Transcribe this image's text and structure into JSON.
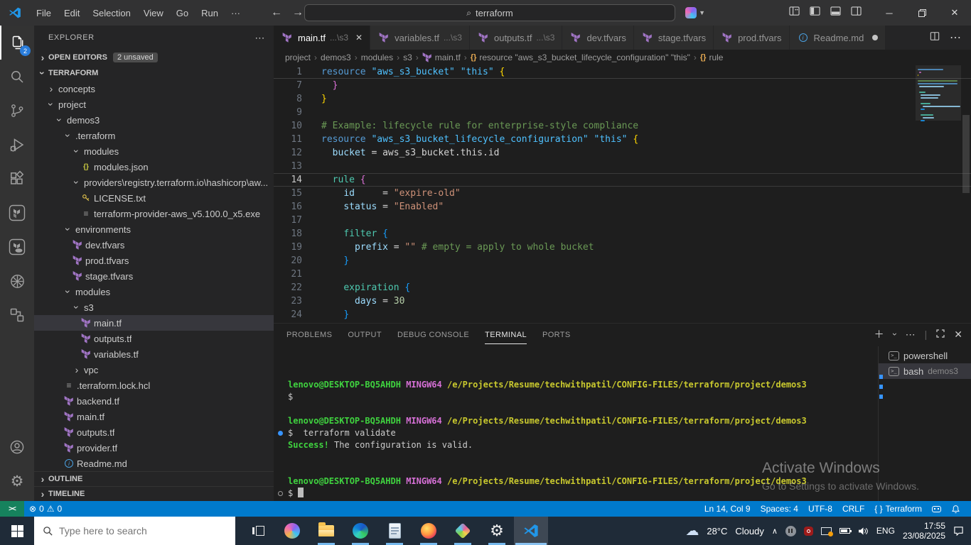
{
  "title_bar": {
    "menus": [
      "File",
      "Edit",
      "Selection",
      "View",
      "Go",
      "Run",
      "···"
    ],
    "search_value": "terraform"
  },
  "activity_bar": {
    "items": [
      {
        "id": "explorer",
        "badge": "2",
        "active": true
      },
      {
        "id": "search"
      },
      {
        "id": "source-control"
      },
      {
        "id": "run-debug"
      },
      {
        "id": "extensions"
      },
      {
        "id": "terraform"
      },
      {
        "id": "terraform-cloud"
      },
      {
        "id": "kubernetes"
      },
      {
        "id": "remote-explorer"
      }
    ],
    "bottom": [
      {
        "id": "account"
      },
      {
        "id": "settings"
      }
    ]
  },
  "sidebar": {
    "title": "EXPLORER",
    "open_editors_label": "OPEN EDITORS",
    "open_editors_badge": "2 unsaved",
    "root_label": "TERRAFORM",
    "sections": [
      "OUTLINE",
      "TIMELINE"
    ],
    "tree": [
      {
        "ind": 1,
        "chev": "closed",
        "label": "concepts"
      },
      {
        "ind": 1,
        "chev": "open",
        "label": "project"
      },
      {
        "ind": 2,
        "chev": "open",
        "label": "demos3"
      },
      {
        "ind": 3,
        "chev": "open",
        "label": ".terraform"
      },
      {
        "ind": 4,
        "chev": "open",
        "label": "modules"
      },
      {
        "ind": 5,
        "icon": "json",
        "label": "modules.json"
      },
      {
        "ind": 4,
        "chev": "open",
        "label": "providers\\registry.terraform.io\\hashicorp\\aw..."
      },
      {
        "ind": 5,
        "icon": "key",
        "label": "LICENSE.txt"
      },
      {
        "ind": 5,
        "icon": "list",
        "label": "terraform-provider-aws_v5.100.0_x5.exe"
      },
      {
        "ind": 3,
        "chev": "open",
        "label": "environments"
      },
      {
        "ind": 4,
        "icon": "terraform",
        "label": "dev.tfvars"
      },
      {
        "ind": 4,
        "icon": "terraform",
        "label": "prod.tfvars"
      },
      {
        "ind": 4,
        "icon": "terraform",
        "label": "stage.tfvars"
      },
      {
        "ind": 3,
        "chev": "open",
        "label": "modules"
      },
      {
        "ind": 4,
        "chev": "open",
        "label": "s3"
      },
      {
        "ind": 5,
        "icon": "terraform",
        "label": "main.tf",
        "selected": true
      },
      {
        "ind": 5,
        "icon": "terraform",
        "label": "outputs.tf"
      },
      {
        "ind": 5,
        "icon": "terraform",
        "label": "variables.tf"
      },
      {
        "ind": 4,
        "chev": "closed",
        "label": "vpc"
      },
      {
        "ind": 3,
        "icon": "list",
        "label": ".terraform.lock.hcl"
      },
      {
        "ind": 3,
        "icon": "terraform",
        "label": "backend.tf"
      },
      {
        "ind": 3,
        "icon": "terraform",
        "label": "main.tf"
      },
      {
        "ind": 3,
        "icon": "terraform",
        "label": "outputs.tf"
      },
      {
        "ind": 3,
        "icon": "terraform",
        "label": "provider.tf"
      },
      {
        "ind": 3,
        "icon": "markdown",
        "label": "Readme.md"
      }
    ]
  },
  "editor": {
    "tabs": [
      {
        "icon": "terraform",
        "label": "main.tf",
        "desc": "...\\s3",
        "active": true,
        "close": true
      },
      {
        "icon": "terraform",
        "label": "variables.tf",
        "desc": "...\\s3"
      },
      {
        "icon": "terraform",
        "label": "outputs.tf",
        "desc": "...\\s3"
      },
      {
        "icon": "terraform",
        "label": "dev.tfvars"
      },
      {
        "icon": "terraform",
        "label": "stage.tfvars"
      },
      {
        "icon": "terraform",
        "label": "prod.tfvars"
      },
      {
        "icon": "markdown",
        "label": "Readme.md",
        "modified": true
      }
    ],
    "breadcrumb": [
      {
        "label": "project"
      },
      {
        "label": "demos3"
      },
      {
        "label": "modules"
      },
      {
        "label": "s3"
      },
      {
        "icon": "terraform",
        "label": "main.tf"
      },
      {
        "icon": "symbol",
        "label": "resource \"aws_s3_bucket_lifecycle_configuration\" \"this\""
      },
      {
        "icon": "symbol",
        "label": "rule"
      }
    ],
    "code": {
      "sticky": {
        "num": "1",
        "tokens": [
          [
            "kw",
            "resource"
          ],
          [
            "pl",
            " "
          ],
          [
            "type",
            "\"aws_s3_bucket\""
          ],
          [
            "pl",
            " "
          ],
          [
            "type",
            "\"this\""
          ],
          [
            "pl",
            " "
          ],
          [
            "b1",
            "{"
          ]
        ]
      },
      "current_line": "14",
      "lines": [
        {
          "num": "7",
          "tokens": [
            [
              "pl",
              "  "
            ],
            [
              "b2",
              "}"
            ]
          ]
        },
        {
          "num": "8",
          "tokens": [
            [
              "b1",
              "}"
            ]
          ]
        },
        {
          "num": "9",
          "tokens": []
        },
        {
          "num": "10",
          "tokens": [
            [
              "cm",
              "# Example: lifecycle rule for enterprise-style compliance"
            ]
          ]
        },
        {
          "num": "11",
          "tokens": [
            [
              "kw",
              "resource"
            ],
            [
              "pl",
              " "
            ],
            [
              "type",
              "\"aws_s3_bucket_lifecycle_configuration\""
            ],
            [
              "pl",
              " "
            ],
            [
              "type",
              "\"this\""
            ],
            [
              "pl",
              " "
            ],
            [
              "b1",
              "{"
            ]
          ]
        },
        {
          "num": "12",
          "tokens": [
            [
              "pl",
              "  "
            ],
            [
              "prop",
              "bucket"
            ],
            [
              "pl",
              " = "
            ],
            [
              "ref",
              "aws_s3_bucket.this.id"
            ]
          ]
        },
        {
          "num": "13",
          "tokens": []
        },
        {
          "num": "14",
          "tokens": [
            [
              "pl",
              "  "
            ],
            [
              "blk",
              "rule"
            ],
            [
              "pl",
              " "
            ],
            [
              "b2",
              "{"
            ]
          ]
        },
        {
          "num": "15",
          "tokens": [
            [
              "pl",
              "    "
            ],
            [
              "prop",
              "id"
            ],
            [
              "pl",
              "     = "
            ],
            [
              "str",
              "\"expire-old\""
            ]
          ]
        },
        {
          "num": "16",
          "tokens": [
            [
              "pl",
              "    "
            ],
            [
              "prop",
              "status"
            ],
            [
              "pl",
              " = "
            ],
            [
              "str",
              "\"Enabled\""
            ]
          ]
        },
        {
          "num": "17",
          "tokens": []
        },
        {
          "num": "18",
          "tokens": [
            [
              "pl",
              "    "
            ],
            [
              "blk",
              "filter"
            ],
            [
              "pl",
              " "
            ],
            [
              "b3",
              "{"
            ]
          ]
        },
        {
          "num": "19",
          "tokens": [
            [
              "pl",
              "      "
            ],
            [
              "prop",
              "prefix"
            ],
            [
              "pl",
              " = "
            ],
            [
              "str",
              "\"\""
            ],
            [
              "pl",
              " "
            ],
            [
              "cm",
              "# empty = apply to whole bucket"
            ]
          ]
        },
        {
          "num": "20",
          "tokens": [
            [
              "pl",
              "    "
            ],
            [
              "b3",
              "}"
            ]
          ]
        },
        {
          "num": "21",
          "tokens": []
        },
        {
          "num": "22",
          "tokens": [
            [
              "pl",
              "    "
            ],
            [
              "blk",
              "expiration"
            ],
            [
              "pl",
              " "
            ],
            [
              "b3",
              "{"
            ]
          ]
        },
        {
          "num": "23",
          "tokens": [
            [
              "pl",
              "      "
            ],
            [
              "prop",
              "days"
            ],
            [
              "pl",
              " = "
            ],
            [
              "num",
              "30"
            ]
          ]
        },
        {
          "num": "24",
          "tokens": [
            [
              "pl",
              "    "
            ],
            [
              "b3",
              "}"
            ]
          ]
        }
      ]
    }
  },
  "panel": {
    "tabs": [
      "PROBLEMS",
      "OUTPUT",
      "DEBUG CONSOLE",
      "TERMINAL",
      "PORTS"
    ],
    "active_tab": "TERMINAL",
    "terminal_lines": [
      {
        "segs": [
          [
            "g",
            "lenovo@DESKTOP-BQ5AHDH"
          ],
          [
            "w",
            " "
          ],
          [
            "m",
            "MINGW64"
          ],
          [
            "w",
            " "
          ],
          [
            "y",
            "/e/Projects/Resume/techwithpatil/CONFIG-FILES/terraform/project/demos3"
          ]
        ]
      },
      {
        "segs": [
          [
            "w",
            "$"
          ]
        ]
      },
      {
        "segs": []
      },
      {
        "segs": [
          [
            "g",
            "lenovo@DESKTOP-BQ5AHDH"
          ],
          [
            "w",
            " "
          ],
          [
            "m",
            "MINGW64"
          ],
          [
            "w",
            " "
          ],
          [
            "y",
            "/e/Projects/Resume/techwithpatil/CONFIG-FILES/terraform/project/demos3"
          ]
        ]
      },
      {
        "dec": "filled",
        "segs": [
          [
            "w",
            "$  terraform validate"
          ]
        ]
      },
      {
        "segs": [
          [
            "gb",
            "Success!"
          ],
          [
            "w",
            " The configuration is valid."
          ]
        ]
      },
      {
        "segs": []
      },
      {
        "segs": []
      },
      {
        "segs": [
          [
            "g",
            "lenovo@DESKTOP-BQ5AHDH"
          ],
          [
            "w",
            " "
          ],
          [
            "m",
            "MINGW64"
          ],
          [
            "w",
            " "
          ],
          [
            "y",
            "/e/Projects/Resume/techwithpatil/CONFIG-FILES/terraform/project/demos3"
          ]
        ]
      },
      {
        "dec": "empty",
        "segs": [
          [
            "w",
            "$ "
          ],
          [
            "cur",
            ""
          ]
        ]
      }
    ],
    "terminals": [
      {
        "name": "powershell"
      },
      {
        "name": "bash",
        "desc": "demos3",
        "selected": true
      }
    ]
  },
  "status_bar": {
    "errors": "0",
    "warnings": "0",
    "line_col": "Ln 14, Col 9",
    "indent": "Spaces: 4",
    "encoding": "UTF-8",
    "eol": "CRLF",
    "language": "Terraform"
  },
  "watermark": {
    "line1": "Activate Windows",
    "line2": "Go to Settings to activate Windows."
  },
  "taskbar": {
    "search_placeholder": "Type here to search",
    "apps": [
      {
        "id": "copilot"
      },
      {
        "id": "file-explorer",
        "running": true
      },
      {
        "id": "edge",
        "running": true
      },
      {
        "id": "notepad",
        "running": true
      },
      {
        "id": "firefox",
        "running": true
      },
      {
        "id": "dev-app",
        "running": true
      },
      {
        "id": "settings",
        "running": true
      },
      {
        "id": "vscode",
        "running": true,
        "active": true
      }
    ],
    "tray": {
      "temperature": "28°C",
      "condition": "Cloudy",
      "language": "ENG",
      "time": "17:55",
      "date": "23/08/2025"
    }
  }
}
